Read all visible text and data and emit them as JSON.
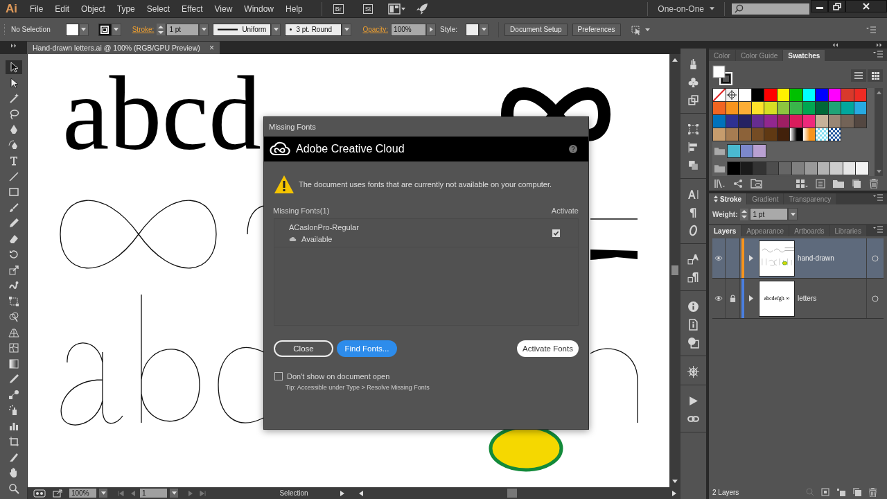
{
  "app_logo": "Ai",
  "menu": [
    "File",
    "Edit",
    "Object",
    "Type",
    "Select",
    "Effect",
    "View",
    "Window",
    "Help"
  ],
  "app_switch": [
    "Br",
    "St"
  ],
  "workspace": "One-on-One",
  "control_bar": {
    "selection": "No Selection",
    "stroke_label": "Stroke:",
    "stroke_weight": "1 pt",
    "profile": "Uniform",
    "brush": "3 pt. Round",
    "opacity_label": "Opacity:",
    "opacity": "100%",
    "style_label": "Style:",
    "buttons": [
      "Document Setup",
      "Preferences"
    ]
  },
  "document_tab": {
    "title": "Hand-drawn letters.ai @ 100% (RGB/GPU Preview)",
    "close": "×"
  },
  "tools": [
    {
      "selected": true
    },
    {
      "selected": false
    },
    {
      "selected": false
    },
    {
      "selected": false
    },
    {
      "selected": false
    },
    {
      "selected": false
    },
    {
      "selected": false
    },
    {
      "selected": false
    },
    {
      "selected": false
    },
    {
      "selected": false
    },
    {
      "selected": false
    },
    {
      "selected": false
    },
    {
      "selected": false
    },
    {
      "selected": false
    },
    {
      "selected": false
    },
    {
      "selected": false
    },
    {
      "selected": false
    },
    {
      "selected": false
    },
    {
      "selected": false
    },
    {
      "selected": false
    },
    {
      "selected": false
    },
    {
      "selected": false
    },
    {
      "selected": false
    },
    {
      "selected": false
    },
    {
      "selected": false
    },
    {
      "selected": false
    },
    {
      "selected": false
    },
    {
      "selected": false
    }
  ],
  "canvas": {
    "text": "abcd"
  },
  "dialog": {
    "title": "Missing Fonts",
    "banner": "Adobe Creative Cloud",
    "message": "The document uses fonts that are currently not available on your computer.",
    "list_header": "Missing Fonts(1)",
    "activate_header": "Activate",
    "fonts": [
      {
        "name": "ACaslonPro-Regular",
        "status": "Available",
        "checked": true
      }
    ],
    "buttons": [
      {
        "label": "Close",
        "kind": "outline"
      },
      {
        "label": "Find Fonts...",
        "kind": "primary"
      },
      {
        "label": "Activate Fonts",
        "kind": "default"
      }
    ],
    "dont_show": {
      "label": "Don't show on document open",
      "checked": false
    },
    "tip": "Tip: Accessible under Type > Resolve Missing Fonts"
  },
  "swatches_panel": {
    "tabs": [
      {
        "label": "Color",
        "selected": false
      },
      {
        "label": "Color Guide",
        "selected": false
      },
      {
        "label": "Swatches",
        "selected": true
      }
    ],
    "rows": [
      {
        "group": false,
        "swatches": [
          {
            "kind": "none"
          },
          {
            "kind": "registration"
          },
          {
            "kind": "color",
            "color": "#ffffff"
          },
          {
            "kind": "color",
            "color": "#000000"
          },
          {
            "kind": "color",
            "color": "#ff0000"
          },
          {
            "kind": "color",
            "color": "#fff200"
          },
          {
            "kind": "color",
            "color": "#00c000"
          },
          {
            "kind": "color",
            "color": "#00ffff"
          },
          {
            "kind": "color",
            "color": "#0000ff"
          },
          {
            "kind": "color",
            "color": "#ff00ff"
          },
          {
            "kind": "color",
            "color": "#d8392b"
          },
          {
            "kind": "color",
            "color": "#ee2b24"
          }
        ]
      },
      {
        "group": false,
        "swatches": [
          {
            "kind": "color",
            "color": "#f26522"
          },
          {
            "kind": "color",
            "color": "#f7941d"
          },
          {
            "kind": "color",
            "color": "#fbad36"
          },
          {
            "kind": "color",
            "color": "#fde22a"
          },
          {
            "kind": "color",
            "color": "#d7df23"
          },
          {
            "kind": "color",
            "color": "#8dc63f"
          },
          {
            "kind": "color",
            "color": "#39b54a"
          },
          {
            "kind": "color",
            "color": "#00a651"
          },
          {
            "kind": "color",
            "color": "#006838"
          },
          {
            "kind": "color",
            "color": "#1fa377"
          },
          {
            "kind": "color",
            "color": "#00a79d"
          },
          {
            "kind": "color",
            "color": "#27aae1"
          }
        ]
      },
      {
        "group": false,
        "swatches": [
          {
            "kind": "color",
            "color": "#0072bc"
          },
          {
            "kind": "color",
            "color": "#2e3192"
          },
          {
            "kind": "color",
            "color": "#262262"
          },
          {
            "kind": "color",
            "color": "#662d91"
          },
          {
            "kind": "color",
            "color": "#92278f"
          },
          {
            "kind": "color",
            "color": "#9e1f63"
          },
          {
            "kind": "color",
            "color": "#da1c5c"
          },
          {
            "kind": "color",
            "color": "#ee2a7b"
          },
          {
            "kind": "color",
            "color": "#c7b299"
          },
          {
            "kind": "color",
            "color": "#998675"
          },
          {
            "kind": "color",
            "color": "#736357"
          },
          {
            "kind": "color",
            "color": "#534741"
          }
        ]
      },
      {
        "group": false,
        "swatches": [
          {
            "kind": "color",
            "color": "#c69c6d"
          },
          {
            "kind": "color",
            "color": "#a67c52"
          },
          {
            "kind": "color",
            "color": "#8c6239"
          },
          {
            "kind": "color",
            "color": "#754c24"
          },
          {
            "kind": "color",
            "color": "#603913"
          },
          {
            "kind": "color",
            "color": "#42210b"
          },
          {
            "kind": "gradient",
            "color": "#000000"
          },
          {
            "kind": "gradient",
            "color": "#f7941d"
          },
          {
            "kind": "pattern",
            "color": "#7fdcf0"
          },
          {
            "kind": "pattern",
            "color": "#1a4f9a"
          }
        ]
      },
      {
        "group": true,
        "swatches": [
          {
            "kind": "color",
            "color": "#4ab9d0"
          },
          {
            "kind": "color",
            "color": "#7c88cc"
          },
          {
            "kind": "color",
            "color": "#b9a0d2"
          }
        ]
      },
      {
        "group": true,
        "swatches": [
          {
            "kind": "color",
            "color": "#000000"
          },
          {
            "kind": "color",
            "color": "#1a1a1a"
          },
          {
            "kind": "color",
            "color": "#333333"
          },
          {
            "kind": "color",
            "color": "#4d4d4d"
          },
          {
            "kind": "color",
            "color": "#666666"
          },
          {
            "kind": "color",
            "color": "#808080"
          },
          {
            "kind": "color",
            "color": "#999999"
          },
          {
            "kind": "color",
            "color": "#b3b3b3"
          },
          {
            "kind": "color",
            "color": "#cccccc"
          },
          {
            "kind": "color",
            "color": "#e6e6e6"
          },
          {
            "kind": "color",
            "color": "#f2f2f2"
          }
        ]
      }
    ]
  },
  "stroke_panel": {
    "tabs": [
      {
        "label": "Stroke",
        "selected": true
      },
      {
        "label": "Gradient",
        "selected": false
      },
      {
        "label": "Transparency",
        "selected": false
      }
    ],
    "weight_label": "Weight:",
    "weight": "1 pt"
  },
  "layers_panel": {
    "tabs": [
      {
        "label": "Layers",
        "selected": true
      },
      {
        "label": "Appearance",
        "selected": false
      },
      {
        "label": "Artboards",
        "selected": false
      },
      {
        "label": "Libraries",
        "selected": false
      }
    ],
    "layers": [
      {
        "name": "hand-drawn",
        "selected": true,
        "visible": true,
        "locked": false,
        "color": "#f7941d"
      },
      {
        "name": "letters",
        "selected": false,
        "visible": true,
        "locked": true,
        "color": "#4a7fe0",
        "thumbnail_text": "abcdefgh ∞"
      }
    ],
    "count": "2 Layers"
  },
  "status_bar": {
    "zoom": "100%",
    "artboard": "1",
    "tool": "Selection"
  }
}
